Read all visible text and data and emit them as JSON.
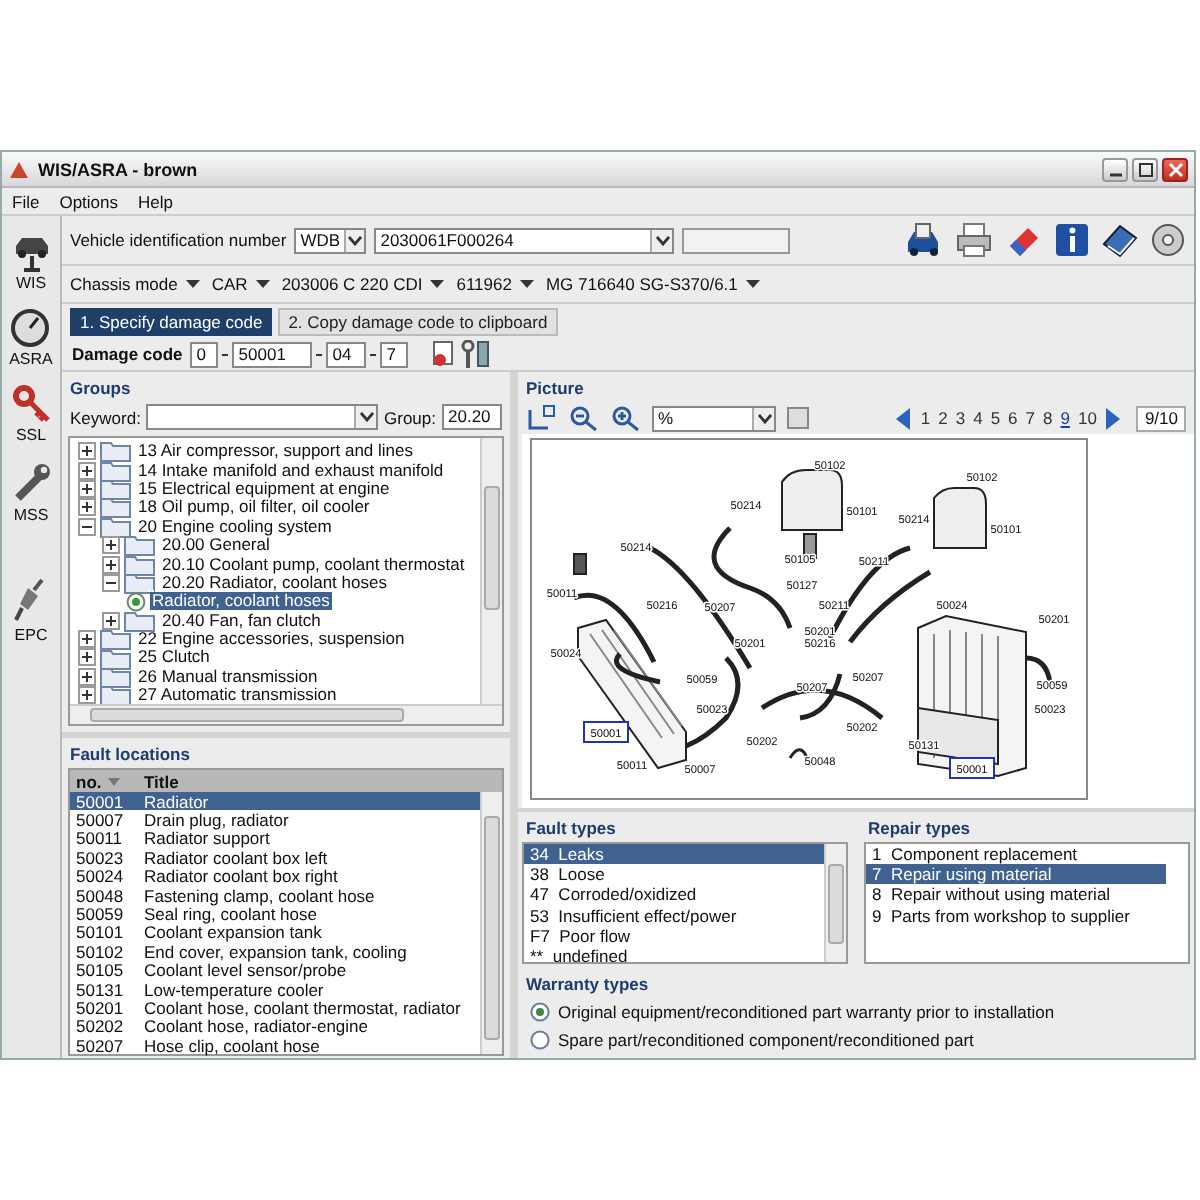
{
  "window": {
    "title": "WIS/ASRA - brown"
  },
  "menu": [
    "File",
    "Options",
    "Help"
  ],
  "sidebar": [
    {
      "label": "WIS",
      "kind": "lift"
    },
    {
      "label": "ASRA",
      "kind": "gauge"
    },
    {
      "label": "SSL",
      "kind": "key"
    },
    {
      "label": "MSS",
      "kind": "wrench"
    },
    {
      "label": "EPC",
      "kind": "plug"
    }
  ],
  "vehicle": {
    "label": "Vehicle identification number",
    "prefix": "WDB",
    "vin": "2030061F000264"
  },
  "chassis": [
    "Chassis mode",
    "CAR",
    "203006 C 220 CDI",
    "611962",
    "MG 716640 SG-S370/6.1"
  ],
  "steps": [
    {
      "label": "1. Specify damage code",
      "selected": true
    },
    {
      "label": "2. Copy damage code to clipboard",
      "selected": false
    }
  ],
  "damage_code": {
    "label": "Damage code",
    "parts": [
      "0",
      "50001",
      "04",
      "7"
    ]
  },
  "groups": {
    "title": "Groups",
    "keyword_label": "Keyword:",
    "group_label": "Group:",
    "group_value": "20.20",
    "tree": [
      {
        "label": "13 Air compressor, support and lines",
        "kind": "folder",
        "expanded": false,
        "selected": false
      },
      {
        "label": "14 Intake manifold and exhaust manifold",
        "kind": "folder",
        "expanded": false,
        "selected": false
      },
      {
        "label": "15 Electrical equipment at engine",
        "kind": "folder",
        "expanded": false,
        "selected": false
      },
      {
        "label": "18 Oil pump, oil filter, oil cooler",
        "kind": "folder",
        "expanded": false,
        "selected": false
      },
      {
        "label": "20 Engine cooling system",
        "kind": "folder",
        "expanded": true,
        "selected": false,
        "children": [
          {
            "label": "20.00 General",
            "kind": "folder",
            "expanded": false,
            "selected": false
          },
          {
            "label": "20.10 Coolant pump, coolant thermostat",
            "kind": "folder",
            "expanded": false,
            "selected": false
          },
          {
            "label": "20.20 Radiator, coolant hoses",
            "kind": "folder",
            "expanded": true,
            "selected": false,
            "children": [
              {
                "label": "Radiator, coolant hoses",
                "kind": "leaf",
                "selected": true
              }
            ]
          },
          {
            "label": "20.40 Fan, fan clutch",
            "kind": "folder",
            "expanded": false,
            "selected": false
          }
        ]
      },
      {
        "label": "22 Engine accessories, suspension",
        "kind": "folder",
        "expanded": false,
        "selected": false
      },
      {
        "label": "25 Clutch",
        "kind": "folder",
        "expanded": false,
        "selected": false
      },
      {
        "label": "26 Manual transmission",
        "kind": "folder",
        "expanded": false,
        "selected": false
      },
      {
        "label": "27 Automatic transmission",
        "kind": "folder",
        "expanded": false,
        "selected": false
      }
    ]
  },
  "fault_locations": {
    "title": "Fault locations",
    "columns": [
      "no.",
      "Title"
    ],
    "rows": [
      {
        "no": "50001",
        "title": "Radiator",
        "selected": true
      },
      {
        "no": "50007",
        "title": "Drain plug, radiator",
        "selected": false
      },
      {
        "no": "50011",
        "title": "Radiator support",
        "selected": false
      },
      {
        "no": "50023",
        "title": "Radiator coolant box left",
        "selected": false
      },
      {
        "no": "50024",
        "title": "Radiator coolant box right",
        "selected": false
      },
      {
        "no": "50048",
        "title": "Fastening clamp, coolant hose",
        "selected": false
      },
      {
        "no": "50059",
        "title": "Seal ring, coolant hose",
        "selected": false
      },
      {
        "no": "50101",
        "title": "Coolant expansion tank",
        "selected": false
      },
      {
        "no": "50102",
        "title": "End cover, expansion tank, cooling",
        "selected": false
      },
      {
        "no": "50105",
        "title": "Coolant level sensor/probe",
        "selected": false
      },
      {
        "no": "50131",
        "title": "Low-temperature cooler",
        "selected": false
      },
      {
        "no": "50201",
        "title": "Coolant hose, coolant thermostat, radiator",
        "selected": false
      },
      {
        "no": "50202",
        "title": "Coolant hose, radiator-engine",
        "selected": false
      },
      {
        "no": "50207",
        "title": "Hose clip, coolant hose",
        "selected": false
      }
    ]
  },
  "picture": {
    "title": "Picture",
    "zoom_value": "%",
    "pages": [
      {
        "label": "1",
        "selected": false
      },
      {
        "label": "2",
        "selected": false
      },
      {
        "label": "3",
        "selected": false
      },
      {
        "label": "4",
        "selected": false
      },
      {
        "label": "5",
        "selected": false
      },
      {
        "label": "6",
        "selected": false
      },
      {
        "label": "7",
        "selected": false
      },
      {
        "label": "8",
        "selected": false
      },
      {
        "label": "9",
        "selected": true
      },
      {
        "label": "10",
        "selected": false
      }
    ],
    "page_indicator": "9/10",
    "callouts": [
      {
        "label": "50102",
        "kind": "plain"
      },
      {
        "label": "50102",
        "kind": "plain"
      },
      {
        "label": "50214",
        "kind": "plain"
      },
      {
        "label": "50101",
        "kind": "plain"
      },
      {
        "label": "50214",
        "kind": "plain"
      },
      {
        "label": "50101",
        "kind": "plain"
      },
      {
        "label": "50214",
        "kind": "plain"
      },
      {
        "label": "50105",
        "kind": "plain"
      },
      {
        "label": "50127",
        "kind": "plain"
      },
      {
        "label": "50211",
        "kind": "plain"
      },
      {
        "label": "50011",
        "kind": "plain"
      },
      {
        "label": "50216",
        "kind": "plain"
      },
      {
        "label": "50207",
        "kind": "plain"
      },
      {
        "label": "50211",
        "kind": "plain"
      },
      {
        "label": "50024",
        "kind": "plain"
      },
      {
        "label": "50201",
        "kind": "plain"
      },
      {
        "label": "50201",
        "kind": "plain"
      },
      {
        "label": "50216",
        "kind": "plain"
      },
      {
        "label": "50201",
        "kind": "plain"
      },
      {
        "label": "50024",
        "kind": "plain"
      },
      {
        "label": "50059",
        "kind": "plain"
      },
      {
        "label": "50207",
        "kind": "plain"
      },
      {
        "label": "50207",
        "kind": "plain"
      },
      {
        "label": "50059",
        "kind": "plain"
      },
      {
        "label": "50023",
        "kind": "plain"
      },
      {
        "label": "50023",
        "kind": "plain"
      },
      {
        "label": "50001",
        "kind": "boxed"
      },
      {
        "label": "50202",
        "kind": "plain"
      },
      {
        "label": "50202",
        "kind": "plain"
      },
      {
        "label": "50131",
        "kind": "plain"
      },
      {
        "label": "50048",
        "kind": "plain"
      },
      {
        "label": "50011",
        "kind": "plain"
      },
      {
        "label": "50007",
        "kind": "plain"
      },
      {
        "label": "50001",
        "kind": "boxed"
      }
    ]
  },
  "fault_types": {
    "title": "Fault types",
    "items": [
      {
        "label": "34  Leaks",
        "selected": true
      },
      {
        "label": "38  Loose",
        "selected": false
      },
      {
        "label": "47  Corroded/oxidized",
        "selected": false
      },
      {
        "label": "53  Insufficient effect/power",
        "selected": false
      },
      {
        "label": "F7  Poor flow",
        "selected": false
      },
      {
        "label": "**  undefined",
        "selected": false
      }
    ]
  },
  "repair_types": {
    "title": "Repair types",
    "items": [
      {
        "label": "1  Component replacement",
        "selected": false
      },
      {
        "label": "7  Repair using material",
        "selected": true
      },
      {
        "label": "8  Repair without using material",
        "selected": false
      },
      {
        "label": "9  Parts from workshop to supplier",
        "selected": false
      }
    ]
  },
  "warranty_types": {
    "title": "Warranty types",
    "options": [
      {
        "label": "Original equipment/reconditioned part warranty prior to installation",
        "selected": true
      },
      {
        "label": "Spare part/reconditioned component/reconditioned part",
        "selected": false
      }
    ]
  }
}
